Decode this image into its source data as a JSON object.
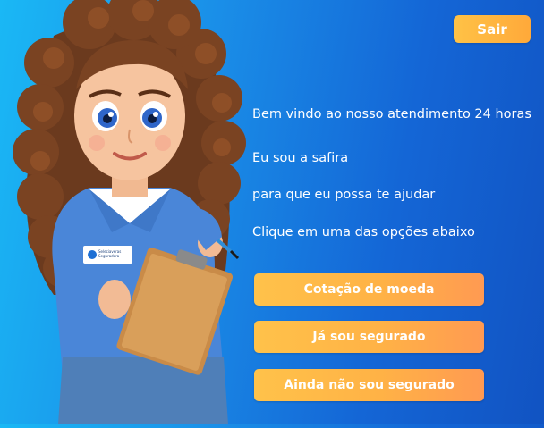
{
  "header": {
    "exit_label": "Sair"
  },
  "assistant": {
    "badge_text": "Seleciaveras Seguradora",
    "messages": [
      "Bem vindo ao nosso atendimento 24 horas",
      "Eu sou a safira",
      "para que eu possa te ajudar",
      "Clique em uma das opções abaixo"
    ]
  },
  "options": [
    {
      "label": "Cotação de moeda"
    },
    {
      "label": "Já sou segurado"
    },
    {
      "label": "Ainda não sou segurado"
    }
  ],
  "colors": {
    "background_start": "#1ab8f5",
    "background_end": "#1153c2",
    "button_start": "#ffc24a",
    "button_end": "#ff9a52",
    "text": "#ffffff"
  }
}
